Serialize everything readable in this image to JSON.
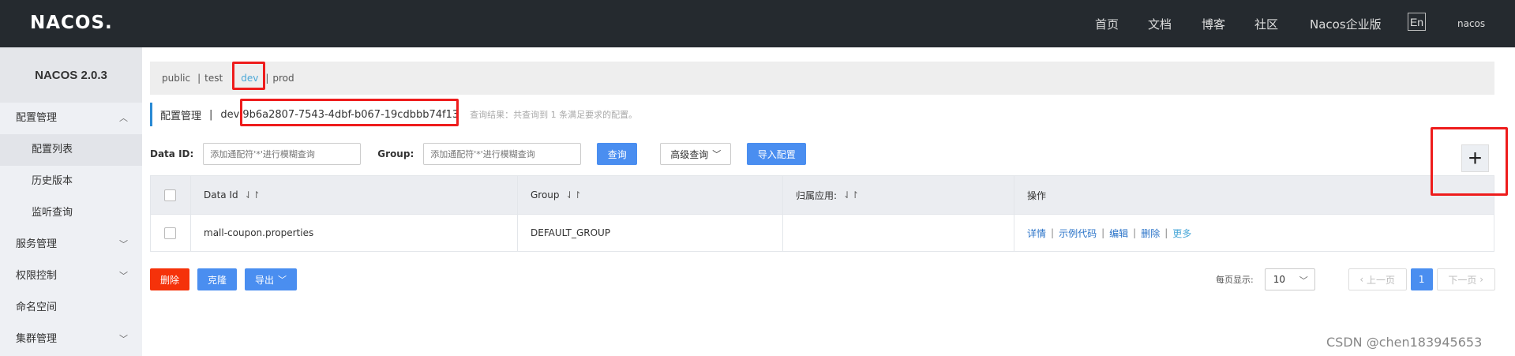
{
  "header": {
    "logo": "NACOS.",
    "nav": [
      "首页",
      "文档",
      "博客",
      "社区",
      "Nacos企业版"
    ],
    "lang": "En",
    "user": "nacos"
  },
  "sidebar": {
    "brand": "NACOS 2.0.3",
    "items": [
      {
        "label": "配置管理",
        "type": "group",
        "expanded": true
      },
      {
        "label": "配置列表",
        "type": "sub",
        "active": true
      },
      {
        "label": "历史版本",
        "type": "sub"
      },
      {
        "label": "监听查询",
        "type": "sub"
      },
      {
        "label": "服务管理",
        "type": "group"
      },
      {
        "label": "权限控制",
        "type": "group"
      },
      {
        "label": "命名空间",
        "type": "item"
      },
      {
        "label": "集群管理",
        "type": "group"
      }
    ]
  },
  "namespaces": {
    "items": [
      "public",
      "test",
      "dev",
      "prod"
    ],
    "active": "dev",
    "separator": "|"
  },
  "title": {
    "section": "配置管理",
    "separator": "|",
    "namespace": "dev",
    "namespace_id": "9b6a2807-7543-4dbf-b067-19cdbbb74f13",
    "query_result": "查询结果：共查询到 1 条满足要求的配置。"
  },
  "search": {
    "data_id_label": "Data ID:",
    "data_id_placeholder": "添加通配符'*'进行模糊查询",
    "group_label": "Group:",
    "group_placeholder": "添加通配符'*'进行模糊查询",
    "query_button": "查询",
    "advanced_query": "高级查询",
    "import_button": "导入配置",
    "add_symbol": "+"
  },
  "table": {
    "columns": [
      "Data Id",
      "Group",
      "归属应用:",
      "操作"
    ],
    "sort_symbol": "⇃↾",
    "rows": [
      {
        "data_id": "mall-coupon.properties",
        "group": "DEFAULT_GROUP",
        "app": "",
        "ops": [
          "详情",
          "示例代码",
          "编辑",
          "删除",
          "更多"
        ]
      }
    ],
    "op_separator": "|"
  },
  "actions": {
    "delete": "删除",
    "clone": "克隆",
    "export": "导出"
  },
  "pagination": {
    "page_size_label": "每页显示:",
    "page_size": "10",
    "prev": "上一页",
    "next": "下一页",
    "current_page": "1"
  },
  "watermark": "CSDN @chen183945653",
  "colors": {
    "topbar": "#252a2f",
    "primary": "#4a8ef0",
    "danger": "#f5320a",
    "annotation": "#ee1c1c"
  }
}
